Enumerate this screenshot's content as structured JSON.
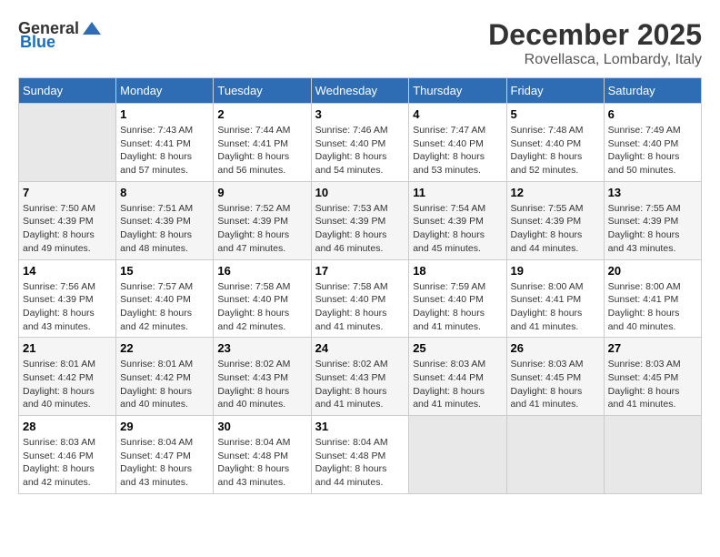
{
  "logo": {
    "text_general": "General",
    "text_blue": "Blue"
  },
  "title": {
    "month": "December 2025",
    "location": "Rovellasca, Lombardy, Italy"
  },
  "weekdays": [
    "Sunday",
    "Monday",
    "Tuesday",
    "Wednesday",
    "Thursday",
    "Friday",
    "Saturday"
  ],
  "weeks": [
    [
      {
        "day": "",
        "sunrise": "",
        "sunset": "",
        "daylight": ""
      },
      {
        "day": "1",
        "sunrise": "Sunrise: 7:43 AM",
        "sunset": "Sunset: 4:41 PM",
        "daylight": "Daylight: 8 hours and 57 minutes."
      },
      {
        "day": "2",
        "sunrise": "Sunrise: 7:44 AM",
        "sunset": "Sunset: 4:41 PM",
        "daylight": "Daylight: 8 hours and 56 minutes."
      },
      {
        "day": "3",
        "sunrise": "Sunrise: 7:46 AM",
        "sunset": "Sunset: 4:40 PM",
        "daylight": "Daylight: 8 hours and 54 minutes."
      },
      {
        "day": "4",
        "sunrise": "Sunrise: 7:47 AM",
        "sunset": "Sunset: 4:40 PM",
        "daylight": "Daylight: 8 hours and 53 minutes."
      },
      {
        "day": "5",
        "sunrise": "Sunrise: 7:48 AM",
        "sunset": "Sunset: 4:40 PM",
        "daylight": "Daylight: 8 hours and 52 minutes."
      },
      {
        "day": "6",
        "sunrise": "Sunrise: 7:49 AM",
        "sunset": "Sunset: 4:40 PM",
        "daylight": "Daylight: 8 hours and 50 minutes."
      }
    ],
    [
      {
        "day": "7",
        "sunrise": "Sunrise: 7:50 AM",
        "sunset": "Sunset: 4:39 PM",
        "daylight": "Daylight: 8 hours and 49 minutes."
      },
      {
        "day": "8",
        "sunrise": "Sunrise: 7:51 AM",
        "sunset": "Sunset: 4:39 PM",
        "daylight": "Daylight: 8 hours and 48 minutes."
      },
      {
        "day": "9",
        "sunrise": "Sunrise: 7:52 AM",
        "sunset": "Sunset: 4:39 PM",
        "daylight": "Daylight: 8 hours and 47 minutes."
      },
      {
        "day": "10",
        "sunrise": "Sunrise: 7:53 AM",
        "sunset": "Sunset: 4:39 PM",
        "daylight": "Daylight: 8 hours and 46 minutes."
      },
      {
        "day": "11",
        "sunrise": "Sunrise: 7:54 AM",
        "sunset": "Sunset: 4:39 PM",
        "daylight": "Daylight: 8 hours and 45 minutes."
      },
      {
        "day": "12",
        "sunrise": "Sunrise: 7:55 AM",
        "sunset": "Sunset: 4:39 PM",
        "daylight": "Daylight: 8 hours and 44 minutes."
      },
      {
        "day": "13",
        "sunrise": "Sunrise: 7:55 AM",
        "sunset": "Sunset: 4:39 PM",
        "daylight": "Daylight: 8 hours and 43 minutes."
      }
    ],
    [
      {
        "day": "14",
        "sunrise": "Sunrise: 7:56 AM",
        "sunset": "Sunset: 4:39 PM",
        "daylight": "Daylight: 8 hours and 43 minutes."
      },
      {
        "day": "15",
        "sunrise": "Sunrise: 7:57 AM",
        "sunset": "Sunset: 4:40 PM",
        "daylight": "Daylight: 8 hours and 42 minutes."
      },
      {
        "day": "16",
        "sunrise": "Sunrise: 7:58 AM",
        "sunset": "Sunset: 4:40 PM",
        "daylight": "Daylight: 8 hours and 42 minutes."
      },
      {
        "day": "17",
        "sunrise": "Sunrise: 7:58 AM",
        "sunset": "Sunset: 4:40 PM",
        "daylight": "Daylight: 8 hours and 41 minutes."
      },
      {
        "day": "18",
        "sunrise": "Sunrise: 7:59 AM",
        "sunset": "Sunset: 4:40 PM",
        "daylight": "Daylight: 8 hours and 41 minutes."
      },
      {
        "day": "19",
        "sunrise": "Sunrise: 8:00 AM",
        "sunset": "Sunset: 4:41 PM",
        "daylight": "Daylight: 8 hours and 41 minutes."
      },
      {
        "day": "20",
        "sunrise": "Sunrise: 8:00 AM",
        "sunset": "Sunset: 4:41 PM",
        "daylight": "Daylight: 8 hours and 40 minutes."
      }
    ],
    [
      {
        "day": "21",
        "sunrise": "Sunrise: 8:01 AM",
        "sunset": "Sunset: 4:42 PM",
        "daylight": "Daylight: 8 hours and 40 minutes."
      },
      {
        "day": "22",
        "sunrise": "Sunrise: 8:01 AM",
        "sunset": "Sunset: 4:42 PM",
        "daylight": "Daylight: 8 hours and 40 minutes."
      },
      {
        "day": "23",
        "sunrise": "Sunrise: 8:02 AM",
        "sunset": "Sunset: 4:43 PM",
        "daylight": "Daylight: 8 hours and 40 minutes."
      },
      {
        "day": "24",
        "sunrise": "Sunrise: 8:02 AM",
        "sunset": "Sunset: 4:43 PM",
        "daylight": "Daylight: 8 hours and 41 minutes."
      },
      {
        "day": "25",
        "sunrise": "Sunrise: 8:03 AM",
        "sunset": "Sunset: 4:44 PM",
        "daylight": "Daylight: 8 hours and 41 minutes."
      },
      {
        "day": "26",
        "sunrise": "Sunrise: 8:03 AM",
        "sunset": "Sunset: 4:45 PM",
        "daylight": "Daylight: 8 hours and 41 minutes."
      },
      {
        "day": "27",
        "sunrise": "Sunrise: 8:03 AM",
        "sunset": "Sunset: 4:45 PM",
        "daylight": "Daylight: 8 hours and 41 minutes."
      }
    ],
    [
      {
        "day": "28",
        "sunrise": "Sunrise: 8:03 AM",
        "sunset": "Sunset: 4:46 PM",
        "daylight": "Daylight: 8 hours and 42 minutes."
      },
      {
        "day": "29",
        "sunrise": "Sunrise: 8:04 AM",
        "sunset": "Sunset: 4:47 PM",
        "daylight": "Daylight: 8 hours and 43 minutes."
      },
      {
        "day": "30",
        "sunrise": "Sunrise: 8:04 AM",
        "sunset": "Sunset: 4:48 PM",
        "daylight": "Daylight: 8 hours and 43 minutes."
      },
      {
        "day": "31",
        "sunrise": "Sunrise: 8:04 AM",
        "sunset": "Sunset: 4:48 PM",
        "daylight": "Daylight: 8 hours and 44 minutes."
      },
      {
        "day": "",
        "sunrise": "",
        "sunset": "",
        "daylight": ""
      },
      {
        "day": "",
        "sunrise": "",
        "sunset": "",
        "daylight": ""
      },
      {
        "day": "",
        "sunrise": "",
        "sunset": "",
        "daylight": ""
      }
    ]
  ]
}
